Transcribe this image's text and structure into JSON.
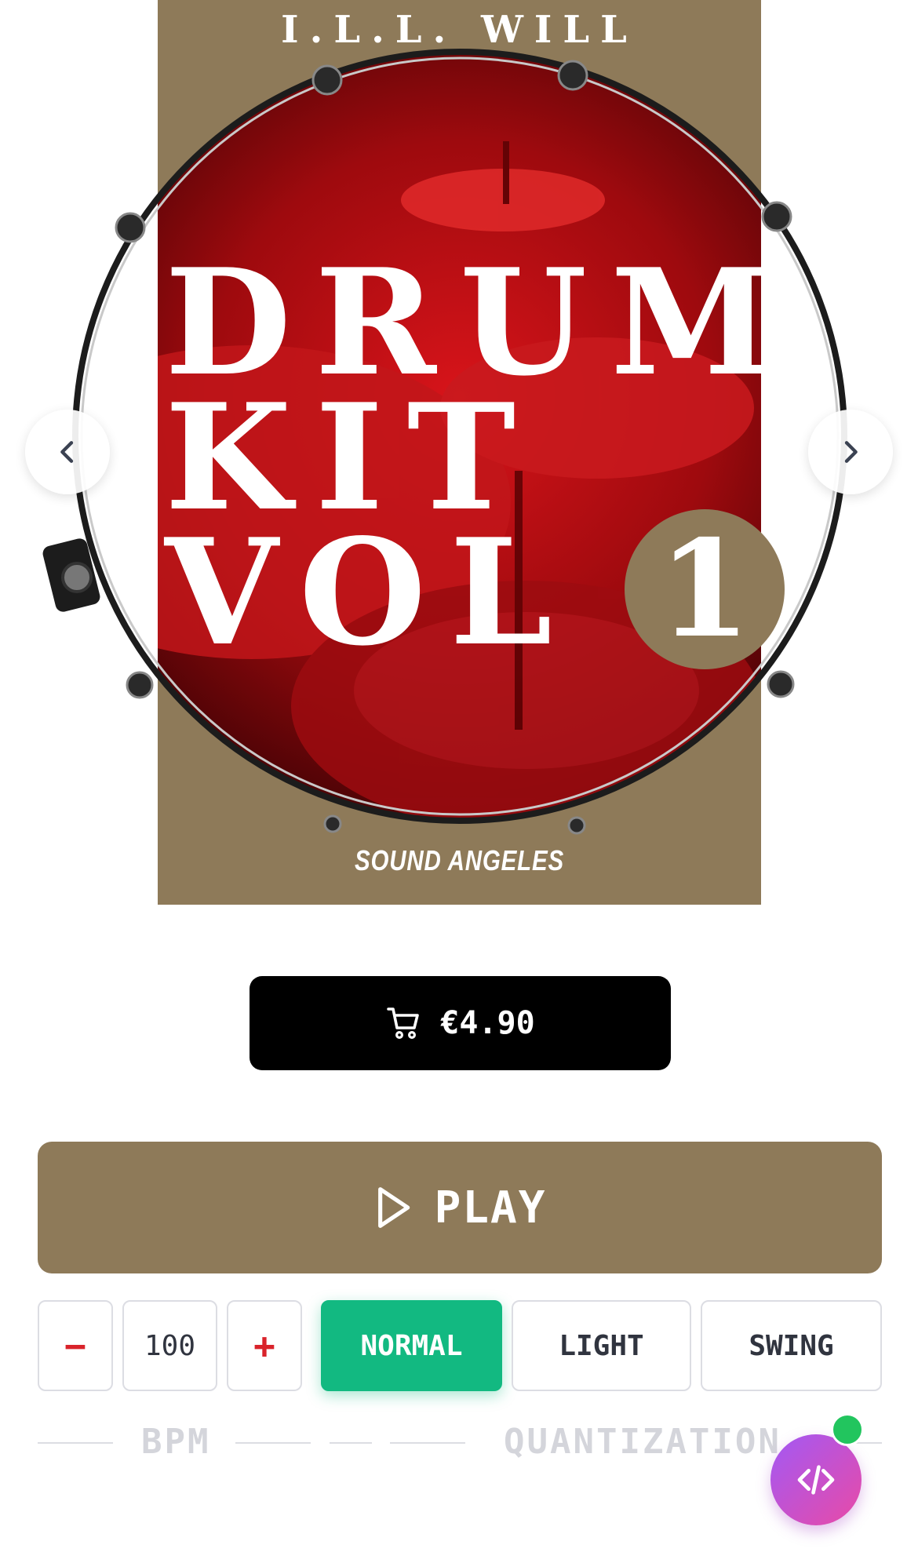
{
  "cover": {
    "artist": "I.L.L. WILL",
    "title_lines": [
      "DRUM",
      "KIT",
      "VOL"
    ],
    "volume": "1",
    "brand": "SOUND ANGELES",
    "background_color": "#8e7a59"
  },
  "nav": {
    "prev_icon": "chevron-left-icon",
    "next_icon": "chevron-right-icon"
  },
  "buy": {
    "icon": "cart-icon",
    "price": "€4.90"
  },
  "player": {
    "icon": "play-icon",
    "label": "PLAY"
  },
  "bpm": {
    "decrement": "−",
    "value": "100",
    "increment": "+",
    "caption": "BPM"
  },
  "quantization": {
    "options": [
      "NORMAL",
      "LIGHT",
      "SWING"
    ],
    "selected": "NORMAL",
    "caption": "QUANTIZATION"
  },
  "fab": {
    "icon": "code-icon",
    "status_color": "#22c55e"
  }
}
